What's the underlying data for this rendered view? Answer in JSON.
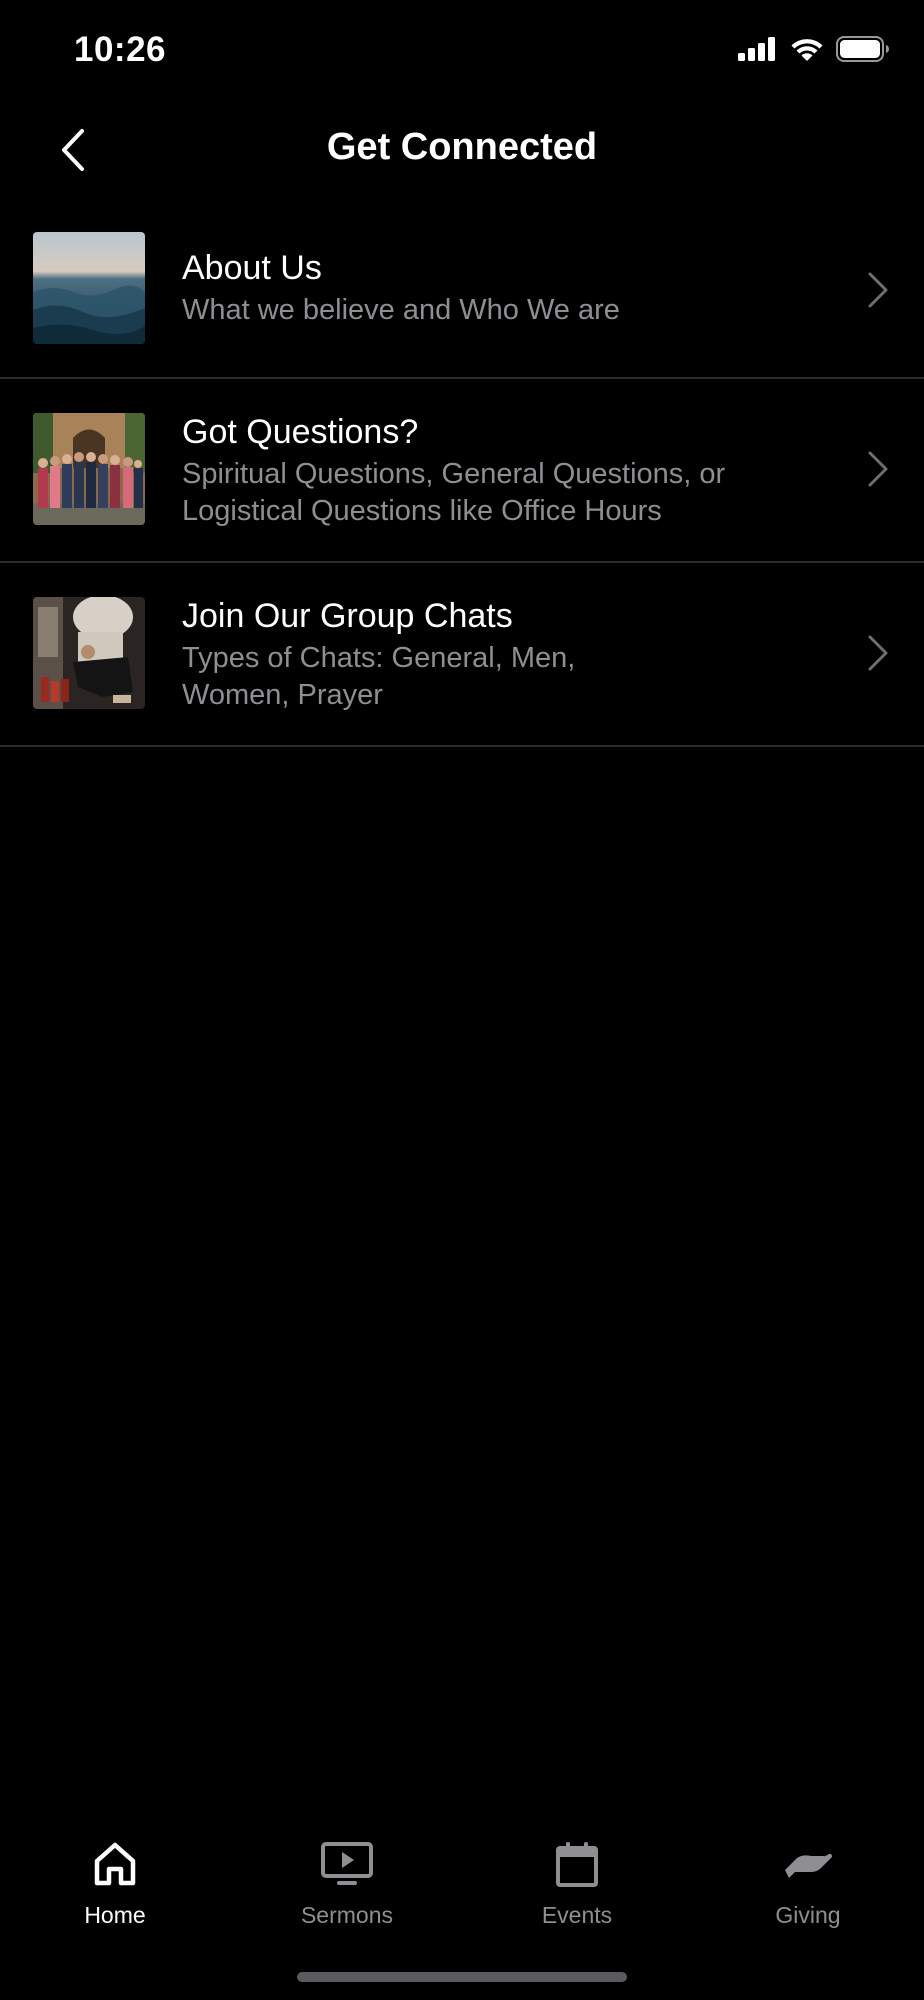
{
  "status_bar": {
    "time": "10:26"
  },
  "nav": {
    "title": "Get Connected"
  },
  "items": [
    {
      "title": "About Us",
      "subtitle": "What we believe and Who We are"
    },
    {
      "title": "Got Questions?",
      "subtitle": "Spiritual Questions, General Questions, or Logistical Questions like Office Hours"
    },
    {
      "title": "Join Our Group Chats",
      "subtitle": "Types of Chats: General, Men, Women, Prayer"
    }
  ],
  "tabs": [
    {
      "label": "Home",
      "icon": "home-icon",
      "active": true
    },
    {
      "label": "Sermons",
      "icon": "play-screen-icon",
      "active": false
    },
    {
      "label": "Events",
      "icon": "calendar-icon",
      "active": false
    },
    {
      "label": "Giving",
      "icon": "giving-hand-icon",
      "active": false
    }
  ],
  "colors": {
    "background": "#000000",
    "separator": "#2c2c2e",
    "secondary_text": "#8e8e93"
  }
}
